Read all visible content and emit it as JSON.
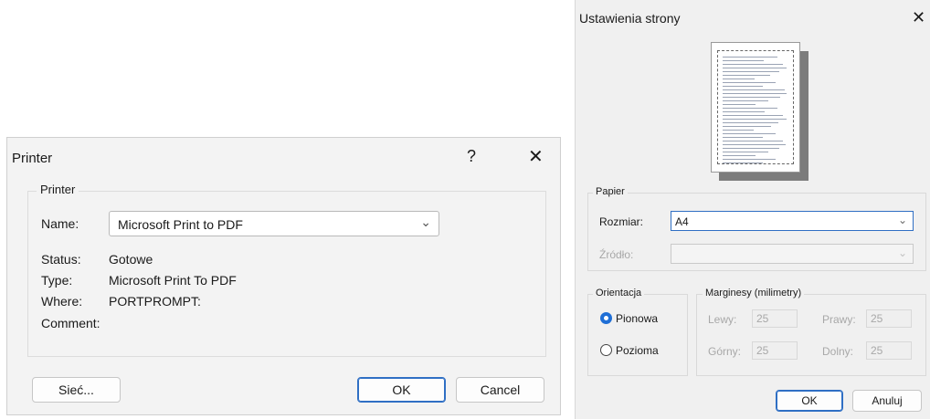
{
  "printer_dialog": {
    "title": "Printer",
    "help_glyph": "?",
    "close_glyph": "✕",
    "group_label": "Printer",
    "name_label": "Name:",
    "name_value": "Microsoft Print to PDF",
    "status_label": "Status:",
    "status_value": "Gotowe",
    "type_label": "Type:",
    "type_value": "Microsoft Print To PDF",
    "where_label": "Where:",
    "where_value": "PORTPROMPT:",
    "comment_label": "Comment:",
    "comment_value": "",
    "network_button": "Sieć...",
    "ok_button": "OK",
    "cancel_button": "Cancel"
  },
  "page_setup_dialog": {
    "title": "Ustawienia strony",
    "close_glyph": "✕",
    "paper_group": "Papier",
    "size_label": "Rozmiar:",
    "size_value": "A4",
    "source_label": "Źródło:",
    "source_value": "",
    "orientation_group": "Orientacja",
    "portrait_label": "Pionowa",
    "landscape_label": "Pozioma",
    "orientation_selected": "Pionowa",
    "margins_group": "Marginesy (milimetry)",
    "left_label": "Lewy:",
    "left_value": "25",
    "right_label": "Prawy:",
    "right_value": "25",
    "top_label": "Górny:",
    "top_value": "25",
    "bottom_label": "Dolny:",
    "bottom_value": "25",
    "ok_button": "OK",
    "cancel_button": "Anuluj"
  },
  "colors": {
    "accent": "#1f6fd6",
    "dialog_bg": "#f3f3f3"
  },
  "icons": [
    "help-icon",
    "close-icon",
    "chevron-down-icon",
    "page-preview"
  ]
}
